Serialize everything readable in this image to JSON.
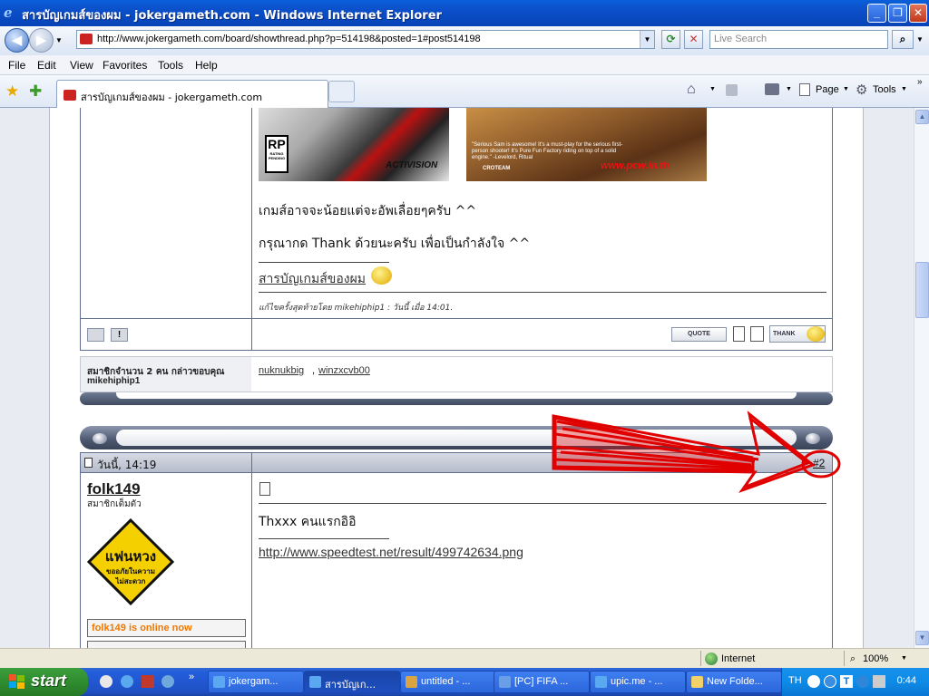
{
  "window": {
    "title": "สารบัญเกมส์ของผม - jokergameth.com - Windows Internet Explorer"
  },
  "address": {
    "url": "http://www.jokergameth.com/board/showthread.php?p=514198&posted=1#post514198",
    "search_placeholder": "Live Search"
  },
  "menu": [
    "File",
    "Edit",
    "View",
    "Favorites",
    "Tools",
    "Help"
  ],
  "tabs": {
    "active_label": "สารบัญเกมส์ของผม - jokergameth.com",
    "page_label": "Page",
    "tools_label": "Tools"
  },
  "post1": {
    "line1": "เกมส์อาจจะน้อยแต่จะอัพเลื่อยๆครับ ^^",
    "line2": "กรุณากด Thank ด้วยนะครับ เพื่อเป็นกำลังใจ ^^",
    "sig_link": "สารบัญเกมส์ของผม",
    "edited": "แก้ไขครั้งสุดท้ายโดย mikehiphip1 : วันนี้ เมื่อ 14:01.",
    "quote_btn": "QUOTE",
    "thank_btn": "THANK",
    "rp_text": "RP",
    "activision": "ACTIVISION",
    "rating_text": "RATING PENDING",
    "banner_text": "\"Serious Sam is awesome! It's a must-play for the serious first-person shooter! It's Pure Fun Factory riding on top of a solid engine.\" -Levelord, Ritual",
    "banner_brand": "CROTEAM",
    "banner_watermark": "www.pcw.in.th"
  },
  "thanks": {
    "label": "สมาชิกจำนวน 2 คน กล่าวขอบคุณ",
    "user": "mikehiphip1",
    "names": [
      "nuknukbig",
      "winzxcvb00"
    ]
  },
  "post2": {
    "date": "วันนี้, 14:19",
    "number": "#2",
    "username": "folk149",
    "user_title": "สมาชิกเต็มตัว",
    "badge_line1": "แฟนหวง",
    "badge_line2": "ขออภัยในความ",
    "badge_line3": "ไม่สะดวก",
    "online": "folk149 is online now",
    "text": "Thxxx คนแรกอิอิ",
    "link": "http://www.speedtest.net/result/499742634.png"
  },
  "status": {
    "zone": "Internet",
    "zoom": "100%"
  },
  "taskbar": {
    "start": "start",
    "tasks": [
      "jokergam...",
      "สารบัญเก...",
      "untitled - ...",
      "[PC] FIFA ...",
      "upic.me - ...",
      "New Folde..."
    ],
    "lang": "TH",
    "clock": "0:44"
  },
  "colors": {
    "titlebar": "#0a5fd8",
    "annotation": "#e00000",
    "online": "#f07800",
    "forum_border": "#606f8f"
  }
}
